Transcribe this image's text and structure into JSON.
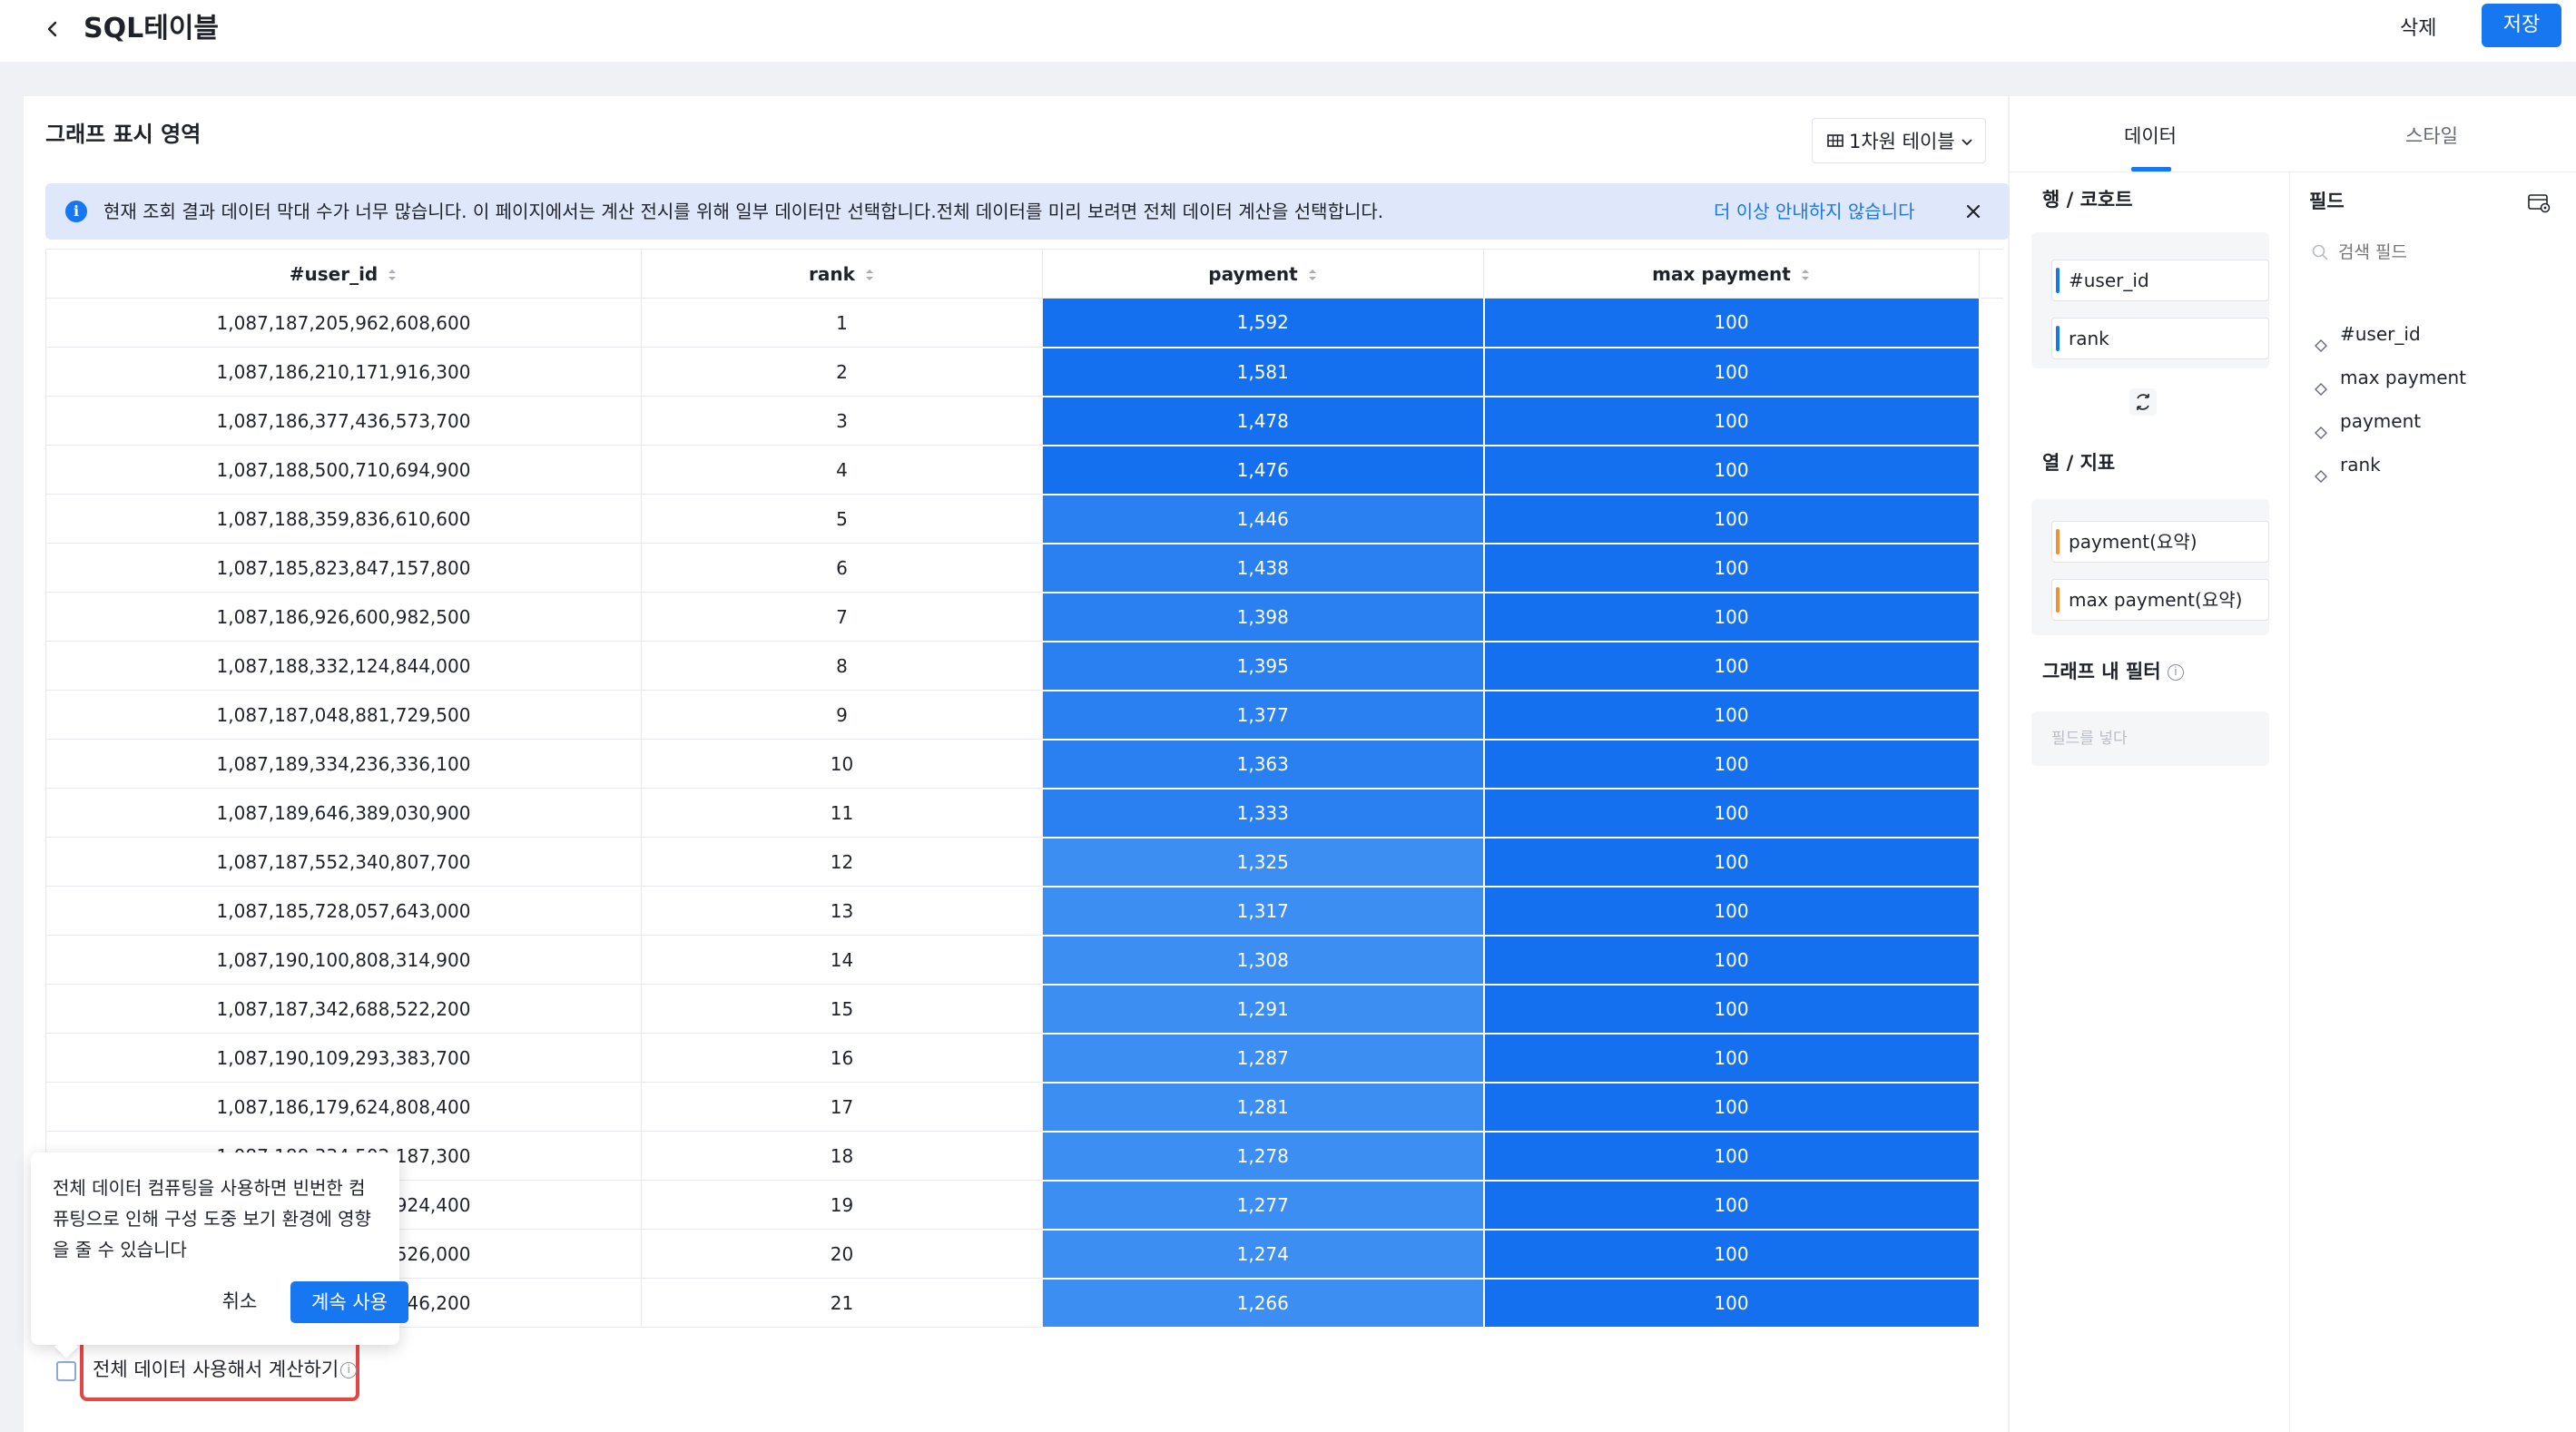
{
  "header": {
    "title": "SQL테이블",
    "delete_label": "삭제",
    "save_label": "저장"
  },
  "graph": {
    "title": "그래프 표시 영역",
    "table_type_label": "1차원 테이블"
  },
  "notice": {
    "message": "현재 조회 결과 데이터 막대 수가 너무 많습니다. 이 페이지에서는 계산 전시를 위해 일부 데이터만 선택합니다.전체 데이터를 미리 보려면 전체 데이터 계산을 선택합니다.",
    "dismiss_label": "더 이상 안내하지 않습니다"
  },
  "table": {
    "columns": [
      "#user_id",
      "rank",
      "payment",
      "max payment"
    ],
    "rows": [
      [
        "1,087,187,205,962,608,600",
        "1",
        "1,592",
        "100"
      ],
      [
        "1,087,186,210,171,916,300",
        "2",
        "1,581",
        "100"
      ],
      [
        "1,087,186,377,436,573,700",
        "3",
        "1,478",
        "100"
      ],
      [
        "1,087,188,500,710,694,900",
        "4",
        "1,476",
        "100"
      ],
      [
        "1,087,188,359,836,610,600",
        "5",
        "1,446",
        "100"
      ],
      [
        "1,087,185,823,847,157,800",
        "6",
        "1,438",
        "100"
      ],
      [
        "1,087,186,926,600,982,500",
        "7",
        "1,398",
        "100"
      ],
      [
        "1,087,188,332,124,844,000",
        "8",
        "1,395",
        "100"
      ],
      [
        "1,087,187,048,881,729,500",
        "9",
        "1,377",
        "100"
      ],
      [
        "1,087,189,334,236,336,100",
        "10",
        "1,363",
        "100"
      ],
      [
        "1,087,189,646,389,030,900",
        "11",
        "1,333",
        "100"
      ],
      [
        "1,087,187,552,340,807,700",
        "12",
        "1,325",
        "100"
      ],
      [
        "1,087,185,728,057,643,000",
        "13",
        "1,317",
        "100"
      ],
      [
        "1,087,190,100,808,314,900",
        "14",
        "1,308",
        "100"
      ],
      [
        "1,087,187,342,688,522,200",
        "15",
        "1,291",
        "100"
      ],
      [
        "1,087,190,109,293,383,700",
        "16",
        "1,287",
        "100"
      ],
      [
        "1,087,186,179,624,808,400",
        "17",
        "1,281",
        "100"
      ],
      [
        "1,087,188,334,502,187,300",
        "18",
        "1,278",
        "100"
      ],
      [
        "1,087,189,125,432,924,400",
        "19",
        "1,277",
        "100"
      ],
      [
        "1,087,186,447,215,526,000",
        "20",
        "1,274",
        "100"
      ],
      [
        "1,087,187,962,337,246,200",
        "21",
        "1,266",
        "100"
      ]
    ],
    "payment_color_dark": "#1470ee",
    "payment_color_light": "#3d8ef2"
  },
  "popover": {
    "text": "전체 데이터 컴퓨팅을 사용하면 빈번한 컴퓨팅으로 인해 구성 도중 보기 환경에 영향을 줄 수 있습니다",
    "cancel_label": "취소",
    "continue_label": "계속 사용"
  },
  "full_data": {
    "label": "전체 데이터 사용해서 계산하기",
    "checked": false
  },
  "right_panel": {
    "tabs": [
      "데이터",
      "스타일"
    ],
    "rows_label": "행 / 코호트",
    "rows": [
      "#user_id",
      "rank"
    ],
    "columns_label": "열 / 지표",
    "columns": [
      "payment(요약)",
      "max payment(요약)"
    ],
    "filter_label": "그래프 내 필터",
    "filter_placeholder": "필드를 넣다",
    "fields_title": "필드",
    "search_placeholder": "검색 필드",
    "fields": [
      "#user_id",
      "max payment",
      "payment",
      "rank"
    ],
    "dimension_color": "#1677f0",
    "measure_color": "#f0913a"
  }
}
